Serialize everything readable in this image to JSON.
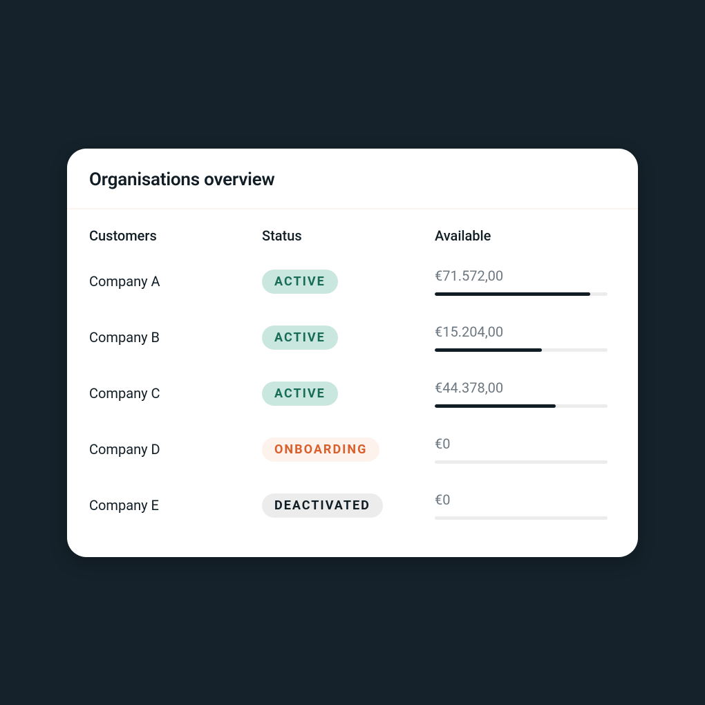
{
  "title": "Organisations overview",
  "columns": {
    "customers": "Customers",
    "status": "Status",
    "available": "Available"
  },
  "status_classes": {
    "ACTIVE": "badge-active",
    "ONBOARDING": "badge-onboarding",
    "DEACTIVATED": "badge-deactivated"
  },
  "rows": [
    {
      "name": "Company A",
      "status": "ACTIVE",
      "available": "€71.572,00",
      "progress": 90
    },
    {
      "name": "Company B",
      "status": "ACTIVE",
      "available": "€15.204,00",
      "progress": 62
    },
    {
      "name": "Company C",
      "status": "ACTIVE",
      "available": "€44.378,00",
      "progress": 70
    },
    {
      "name": "Company D",
      "status": "ONBOARDING",
      "available": "€0",
      "progress": 0
    },
    {
      "name": "Company E",
      "status": "DEACTIVATED",
      "available": "€0",
      "progress": 0
    }
  ]
}
